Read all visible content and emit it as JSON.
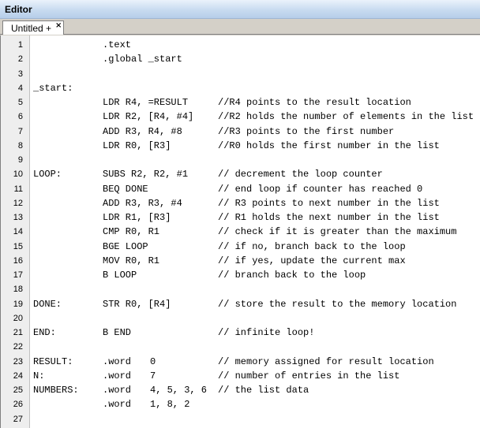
{
  "window": {
    "title": "Editor"
  },
  "tabs": [
    {
      "label": "Untitled +",
      "close_glyph": "×"
    }
  ],
  "lines": [
    {
      "num": "1",
      "label": "",
      "instr": ".text",
      "args": "",
      "comment": ""
    },
    {
      "num": "2",
      "label": "",
      "instr": ".global _start",
      "args": "",
      "comment": ""
    },
    {
      "num": "3",
      "label": "",
      "instr": "",
      "args": "",
      "comment": ""
    },
    {
      "num": "4",
      "label": "_start:",
      "instr": "",
      "args": "",
      "comment": ""
    },
    {
      "num": "5",
      "label": "",
      "instr": "LDR R4, =RESULT",
      "args": "",
      "comment": "//R4 points to the result location"
    },
    {
      "num": "6",
      "label": "",
      "instr": "LDR R2, [R4, #4]",
      "args": "",
      "comment": "//R2 holds the number of elements in the list"
    },
    {
      "num": "7",
      "label": "",
      "instr": "ADD R3, R4, #8",
      "args": "",
      "comment": "//R3 points to the first number"
    },
    {
      "num": "8",
      "label": "",
      "instr": "LDR R0, [R3]",
      "args": "",
      "comment": "//R0 holds the first number in the list"
    },
    {
      "num": "9",
      "label": "",
      "instr": "",
      "args": "",
      "comment": ""
    },
    {
      "num": "10",
      "label": "LOOP:",
      "instr": "SUBS R2, R2, #1",
      "args": "",
      "comment": "// decrement the loop counter"
    },
    {
      "num": "11",
      "label": "",
      "instr": "BEQ DONE",
      "args": "",
      "comment": "// end loop if counter has reached 0"
    },
    {
      "num": "12",
      "label": "",
      "instr": "ADD R3, R3, #4",
      "args": "",
      "comment": "// R3 points to next number in the list"
    },
    {
      "num": "13",
      "label": "",
      "instr": "LDR R1, [R3]",
      "args": "",
      "comment": "// R1 holds the next number in the list"
    },
    {
      "num": "14",
      "label": "",
      "instr": "CMP R0, R1",
      "args": "",
      "comment": "// check if it is greater than the maximum"
    },
    {
      "num": "15",
      "label": "",
      "instr": "BGE LOOP",
      "args": "",
      "comment": "// if no, branch back to the loop"
    },
    {
      "num": "16",
      "label": "",
      "instr": "MOV R0, R1",
      "args": "",
      "comment": "// if yes, update the current max"
    },
    {
      "num": "17",
      "label": "",
      "instr": "B LOOP",
      "args": "",
      "comment": "// branch back to the loop"
    },
    {
      "num": "18",
      "label": "",
      "instr": "",
      "args": "",
      "comment": ""
    },
    {
      "num": "19",
      "label": "DONE:",
      "instr": "STR R0, [R4]",
      "args": "",
      "comment": "// store the result to the memory location"
    },
    {
      "num": "20",
      "label": "",
      "instr": "",
      "args": "",
      "comment": ""
    },
    {
      "num": "21",
      "label": "END:",
      "instr": "B END",
      "args": "",
      "comment": "// infinite loop!"
    },
    {
      "num": "22",
      "label": "",
      "instr": "",
      "args": "",
      "comment": ""
    },
    {
      "num": "23",
      "label": "RESULT:",
      "instr": ".word",
      "args": "0",
      "comment": "// memory assigned for result location"
    },
    {
      "num": "24",
      "label": "N:",
      "instr": ".word",
      "args": "7",
      "comment": "// number of entries in the list"
    },
    {
      "num": "25",
      "label": "NUMBERS:",
      "instr": ".word",
      "args": "4, 5, 3, 6",
      "comment": "// the list data"
    },
    {
      "num": "26",
      "label": "",
      "instr": ".word",
      "args": "1, 8, 2",
      "comment": ""
    },
    {
      "num": "27",
      "label": "",
      "instr": "",
      "args": "",
      "comment": ""
    }
  ]
}
